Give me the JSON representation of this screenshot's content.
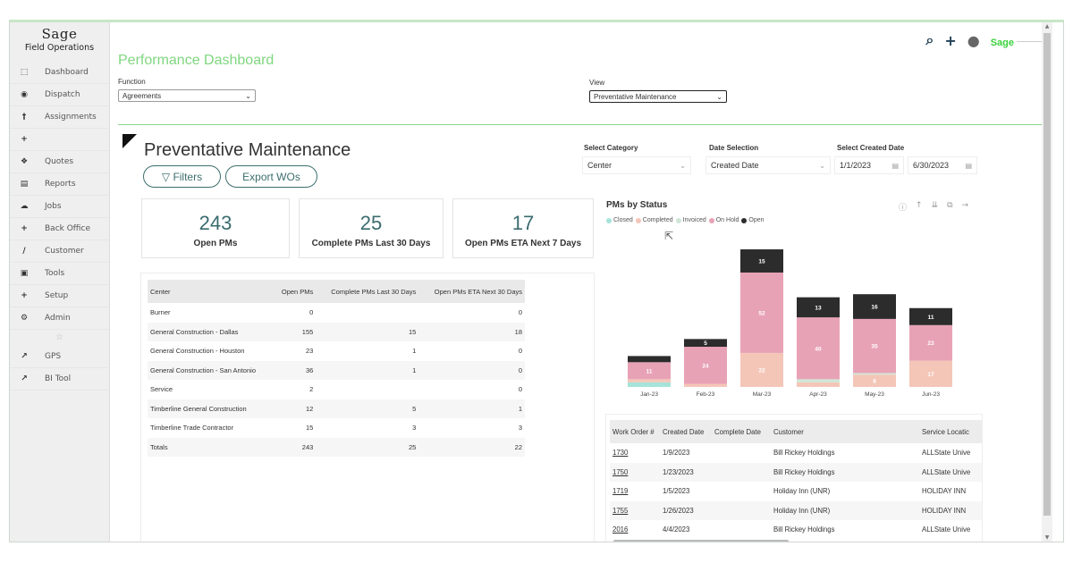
{
  "sidebar": {
    "brand": "Sage",
    "subtitle": "Field Operations",
    "items": [
      {
        "label": "Dashboard",
        "icon": "chart-icon",
        "glyph": "⬚"
      },
      {
        "label": "Dispatch",
        "icon": "map-pin-icon",
        "glyph": "◉"
      },
      {
        "label": "Assignments",
        "icon": "pushpin-icon",
        "glyph": "†"
      },
      {
        "label": "",
        "icon": "plus-icon",
        "glyph": "+"
      },
      {
        "label": "Quotes",
        "icon": "quote-icon",
        "glyph": "❖"
      },
      {
        "label": "Reports",
        "icon": "report-icon",
        "glyph": "▤"
      },
      {
        "label": "Jobs",
        "icon": "jobs-icon",
        "glyph": "☁"
      },
      {
        "label": "Back Office",
        "icon": "plus-icon",
        "glyph": "+"
      },
      {
        "label": "Customer",
        "icon": "pencil-icon",
        "glyph": "∕"
      },
      {
        "label": "Tools",
        "icon": "toolbox-icon",
        "glyph": "▣"
      },
      {
        "label": "Setup",
        "icon": "plus-icon",
        "glyph": "+"
      },
      {
        "label": "Admin",
        "icon": "users-gear-icon",
        "glyph": "⚙"
      }
    ],
    "star": "☆",
    "links": [
      {
        "label": "GPS",
        "icon": "external-link-icon",
        "glyph": "↗"
      },
      {
        "label": "BI Tool",
        "icon": "external-link-icon",
        "glyph": "↗"
      }
    ]
  },
  "header": {
    "title": "Performance Dashboard",
    "function_label": "Function",
    "function_value": "Agreements",
    "view_label": "View",
    "view_value": "Preventative Maintenance",
    "logo": "Sage",
    "search_icon": "⌕",
    "plus_icon": "+",
    "user_icon": "●"
  },
  "report": {
    "title": "Preventative Maintenance",
    "filters_label": "▽ Filters",
    "export_label": "Export WOs",
    "kpis": [
      {
        "value": "243",
        "label": "Open PMs"
      },
      {
        "value": "25",
        "label": "Complete PMs Last 30 Days"
      },
      {
        "value": "17",
        "label": "Open PMs ETA Next 7 Days"
      }
    ],
    "filters": {
      "category_label": "Select Category",
      "category_value": "Center",
      "date_sel_label": "Date Selection",
      "date_sel_value": "Created Date",
      "created_label": "Select Created Date",
      "start_date": "1/1/2023",
      "end_date": "6/30/2023"
    },
    "center_table": {
      "headers": [
        "Center",
        "Open PMs",
        "Complete PMs Last 30 Days",
        "Open PMs ETA Next 30 Days"
      ],
      "rows": [
        [
          "Burner",
          "0",
          "",
          "0"
        ],
        [
          "General Construction - Dallas",
          "155",
          "15",
          "18"
        ],
        [
          "General Construction - Houston",
          "23",
          "1",
          "0"
        ],
        [
          "General Construction - San Antonio",
          "36",
          "1",
          "0"
        ],
        [
          "Service",
          "2",
          "",
          "0"
        ],
        [
          "Timberline General Construction",
          "12",
          "5",
          "1"
        ],
        [
          "Timberline Trade Contractor",
          "15",
          "3",
          "3"
        ],
        [
          "Totals",
          "243",
          "25",
          "22"
        ]
      ]
    },
    "wo_table": {
      "headers": [
        "Work Order #",
        "Created Date",
        "Complete Date",
        "Customer",
        "Service Locatic"
      ],
      "rows": [
        [
          "1730",
          "1/9/2023",
          "",
          "Bill Rickey Holdings",
          "ALLState Unive"
        ],
        [
          "1750",
          "1/23/2023",
          "",
          "Bill Rickey Holdings",
          "ALLState Unive"
        ],
        [
          "1719",
          "1/5/2023",
          "",
          "Holiday Inn (UNR)",
          "HOLIDAY INN"
        ],
        [
          "1755",
          "1/26/2023",
          "",
          "Holiday Inn (UNR)",
          "HOLIDAY INN"
        ],
        [
          "2016",
          "4/4/2023",
          "",
          "Bill Rickey Holdings",
          "ALLState Unive"
        ]
      ]
    },
    "chart_tools": [
      "ⓘ",
      "↑",
      "⇊",
      "⧉",
      "→"
    ]
  },
  "chart_data": {
    "type": "bar",
    "stacked": true,
    "title": "PMs by Status",
    "categories": [
      "Jan-23",
      "Feb-23",
      "Mar-23",
      "Apr-23",
      "May-23",
      "Jun-23"
    ],
    "series": [
      {
        "name": "Closed",
        "color": "#a6e3d8",
        "values": [
          3,
          0,
          0,
          0,
          0,
          0
        ]
      },
      {
        "name": "Completed",
        "color": "#f4c6b8",
        "values": [
          2,
          2,
          22,
          3,
          8,
          17
        ]
      },
      {
        "name": "Invoiced",
        "color": "#cfe6d6",
        "values": [
          0,
          0,
          0,
          2,
          1,
          0
        ]
      },
      {
        "name": "On Hold",
        "color": "#e8a2b6",
        "values": [
          11,
          24,
          52,
          40,
          35,
          23
        ]
      },
      {
        "name": "Open",
        "color": "#2c2c2c",
        "values": [
          4,
          5,
          15,
          13,
          16,
          11
        ]
      }
    ],
    "labeled_threshold": 5,
    "legend_position": "top-left",
    "grid": false
  }
}
